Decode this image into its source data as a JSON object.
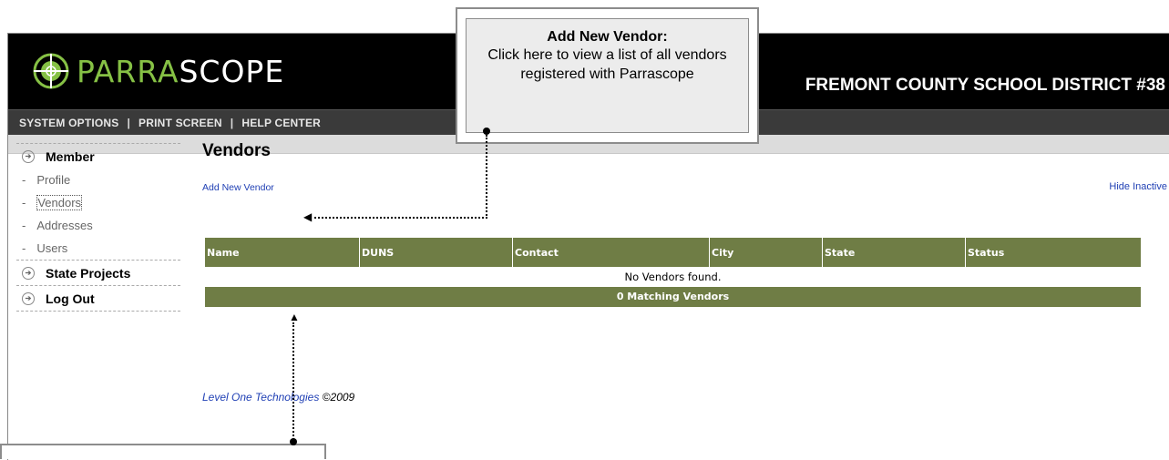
{
  "header": {
    "logo_prefix": "PARRA",
    "logo_suffix": "SCOPE",
    "district": "FREMONT COUNTY SCHOOL DISTRICT #38",
    "nav": [
      "SYSTEM OPTIONS",
      "PRINT SCREEN",
      "HELP CENTER"
    ],
    "nav_sep": "|"
  },
  "sidebar": {
    "sections": [
      {
        "label": "Member",
        "items": [
          "Profile",
          "Vendors",
          "Addresses",
          "Users"
        ],
        "active": "Vendors"
      },
      {
        "label": "State Projects"
      },
      {
        "label": "Log Out"
      }
    ]
  },
  "main": {
    "title": "Vendors",
    "add_link": "Add New Vendor",
    "hide_link": "Hide Inactive",
    "columns": [
      "Name",
      "DUNS",
      "Contact",
      "City",
      "State",
      "Status"
    ],
    "empty_message": "No Vendors found.",
    "footer_count": "0 Matching Vendors"
  },
  "footer": {
    "company": "Level One Technologies",
    "copyright": "©2009"
  },
  "callout": {
    "title": "Add New Vendor:",
    "body": "Click here to view a list of all vendors registered with Parrascope"
  },
  "colors": {
    "header_bg": "#000000",
    "logo_accent": "#86c145",
    "table_header": "#6f7d45",
    "link": "#1f3fb4"
  }
}
